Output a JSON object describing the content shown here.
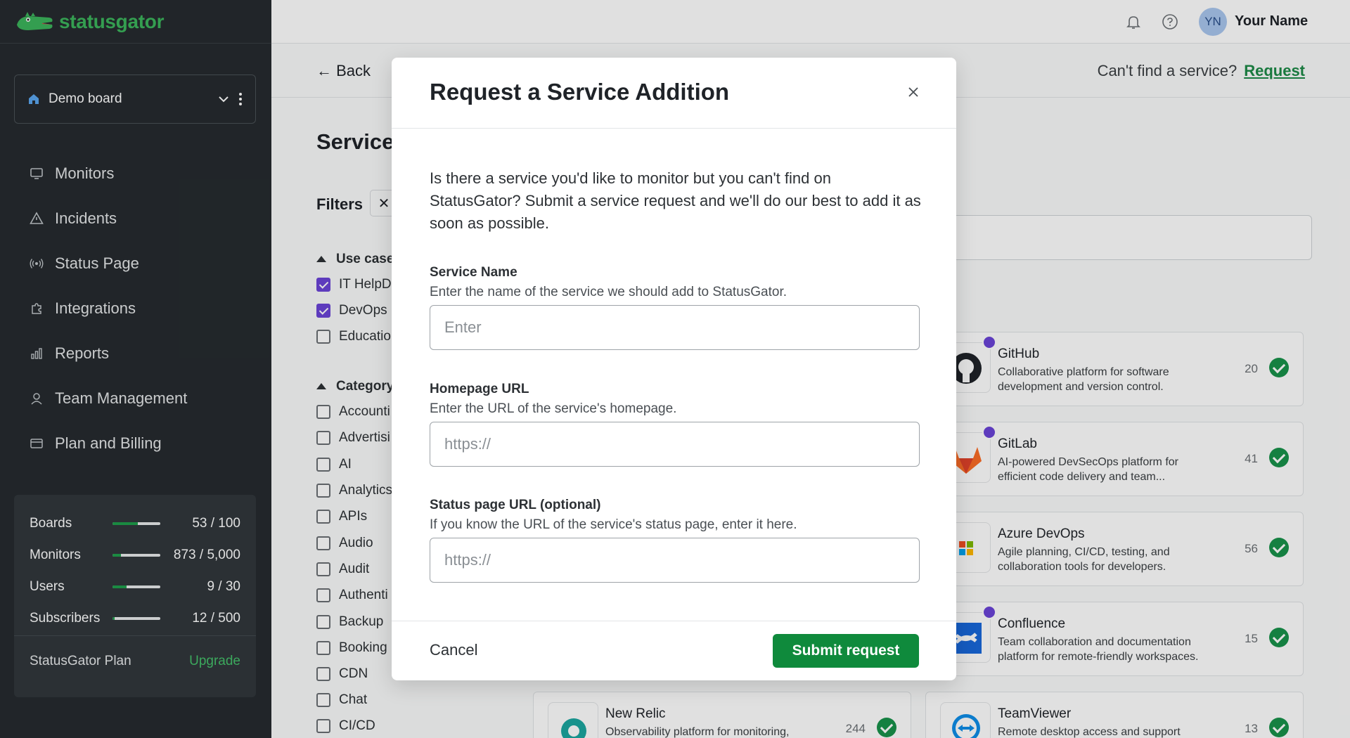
{
  "app": {
    "logo_text": "statusgator"
  },
  "sidebar": {
    "board": "Demo board",
    "items": [
      {
        "label": "Monitors",
        "icon": "monitor-icon"
      },
      {
        "label": "Incidents",
        "icon": "warning-icon"
      },
      {
        "label": "Status Page",
        "icon": "broadcast-icon"
      },
      {
        "label": "Integrations",
        "icon": "puzzle-icon"
      },
      {
        "label": "Reports",
        "icon": "bar-chart-icon"
      },
      {
        "label": "Team Management",
        "icon": "user-icon"
      },
      {
        "label": "Plan and Billing",
        "icon": "credit-card-icon"
      }
    ],
    "usage": [
      {
        "name": "Boards",
        "value": "53 / 100",
        "fraction": 0.53
      },
      {
        "name": "Monitors",
        "value": "873 / 5,000",
        "fraction": 0.17
      },
      {
        "name": "Users",
        "value": "9 / 30",
        "fraction": 0.3
      },
      {
        "name": "Subscribers",
        "value": "12 / 500",
        "fraction": 0.02
      }
    ],
    "plan_label": "StatusGator Plan",
    "upgrade_label": "Upgrade"
  },
  "topbar": {
    "avatar_initials": "YN",
    "user_name": "Your Name"
  },
  "page": {
    "back_label": "← Back",
    "cant_find": "Can't find a service?",
    "request_link": "Request",
    "title": "Service",
    "filters_label": "Filters",
    "filter_chip": "✕",
    "use_case_group": "Use case",
    "use_cases": [
      {
        "label": "IT HelpD",
        "checked": true
      },
      {
        "label": "DevOps",
        "checked": true
      },
      {
        "label": "Educatio",
        "checked": false
      }
    ],
    "category_group": "Category",
    "categories": [
      "Accounti",
      "Advertisi",
      "AI",
      "Analytics",
      "APIs",
      "Audio",
      "Audit",
      "Authenti",
      "Backup",
      "Booking",
      "CDN",
      "Chat",
      "CI/CD"
    ],
    "cards": [
      {
        "name": "GitHub",
        "desc": "Collaborative platform for software development and version control.",
        "count": "20"
      },
      {
        "name": "GitLab",
        "desc": "AI-powered DevSecOps platform for efficient code delivery and team...",
        "count": "41"
      },
      {
        "name": "Azure DevOps",
        "desc": "Agile planning, CI/CD, testing, and collaboration tools for developers.",
        "count": "56"
      },
      {
        "name": "Confluence",
        "desc": "Team collaboration and documentation platform for remote-friendly workspaces.",
        "count": "15"
      },
      {
        "name": "TeamViewer",
        "desc": "Remote desktop access and support",
        "count": "13"
      },
      {
        "name": "New Relic",
        "desc": "Observability platform for monitoring,",
        "count": "244"
      }
    ]
  },
  "modal": {
    "title": "Request a Service Addition",
    "intro": "Is there a service you'd like to monitor but you can't find on StatusGator? Submit a service request and we'll do our best to add it as soon as possible.",
    "service_name": {
      "label": "Service Name",
      "help": "Enter the name of the service we should add to StatusGator.",
      "placeholder": "Enter",
      "value": ""
    },
    "homepage_url": {
      "label": "Homepage URL",
      "help": "Enter the URL of the service's homepage.",
      "placeholder": "https://",
      "value": ""
    },
    "status_page_url": {
      "label": "Status page URL (optional)",
      "help": "If you know the URL of the service's status page, enter it here.",
      "placeholder": "https://",
      "value": ""
    },
    "cancel_label": "Cancel",
    "submit_label": "Submit request"
  },
  "colors": {
    "brand_green": "#0f8a3c",
    "accent_purple": "#6a44d8",
    "sidebar_bg": "#262b2f"
  }
}
